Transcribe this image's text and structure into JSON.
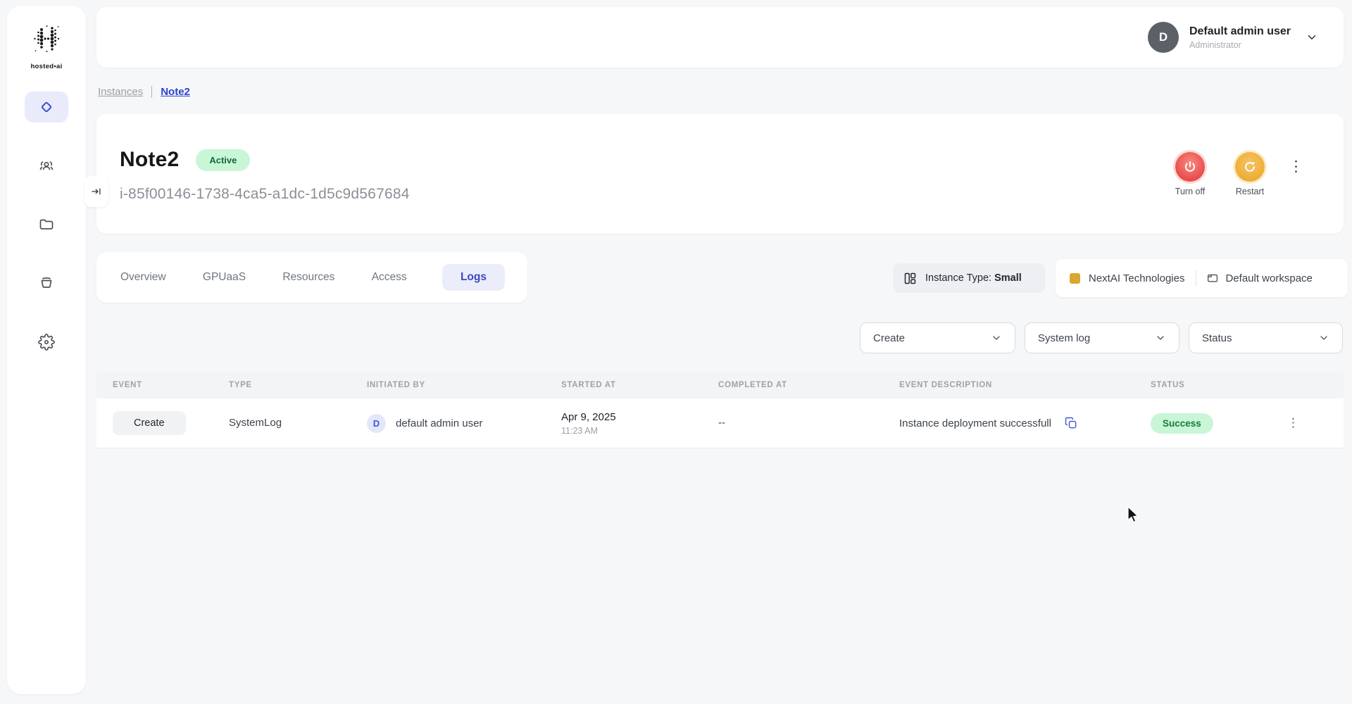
{
  "colors": {
    "accent_blue": "#3a46c6",
    "link_blue": "#2b43cf",
    "success_bg": "#c9f6d7",
    "success_text": "#157a3b",
    "danger_red": "#e84c4c",
    "warning_amber": "#eead33",
    "org_swatch": "#d9a630"
  },
  "sidebar": {
    "logo_label": "hosted•ai"
  },
  "user_menu": {
    "initial": "D",
    "name": "Default admin user",
    "role": "Administrator"
  },
  "breadcrumb": {
    "parent": "Instances",
    "current": "Note2"
  },
  "instance": {
    "name": "Note2",
    "status": "Active",
    "id": "i-85f00146-1738-4ca5-a1dc-1d5c9d567684",
    "turn_off_label": "Turn off",
    "restart_label": "Restart"
  },
  "tabs": {
    "items": [
      "Overview",
      "GPUaaS",
      "Resources",
      "Access",
      "Logs"
    ],
    "active": "Logs"
  },
  "meta": {
    "instance_type_label": "Instance Type: ",
    "instance_type_value": "Small",
    "organization": "NextAI Technologies",
    "workspace": "Default workspace"
  },
  "filters": {
    "event": "Create",
    "log_type": "System log",
    "status": "Status"
  },
  "logs_table": {
    "columns": [
      "EVENT",
      "TYPE",
      "INITIATED BY",
      "STARTED AT",
      "COMPLETED AT",
      "EVENT DESCRIPTION",
      "STATUS"
    ],
    "rows": [
      {
        "event": "Create",
        "type": "SystemLog",
        "initiated_by_initial": "D",
        "initiated_by": "default admin user",
        "started_date": "Apr 9, 2025",
        "started_time": "11:23 AM",
        "completed_at": "--",
        "description": "Instance deployment successfull",
        "status": "Success"
      }
    ]
  }
}
